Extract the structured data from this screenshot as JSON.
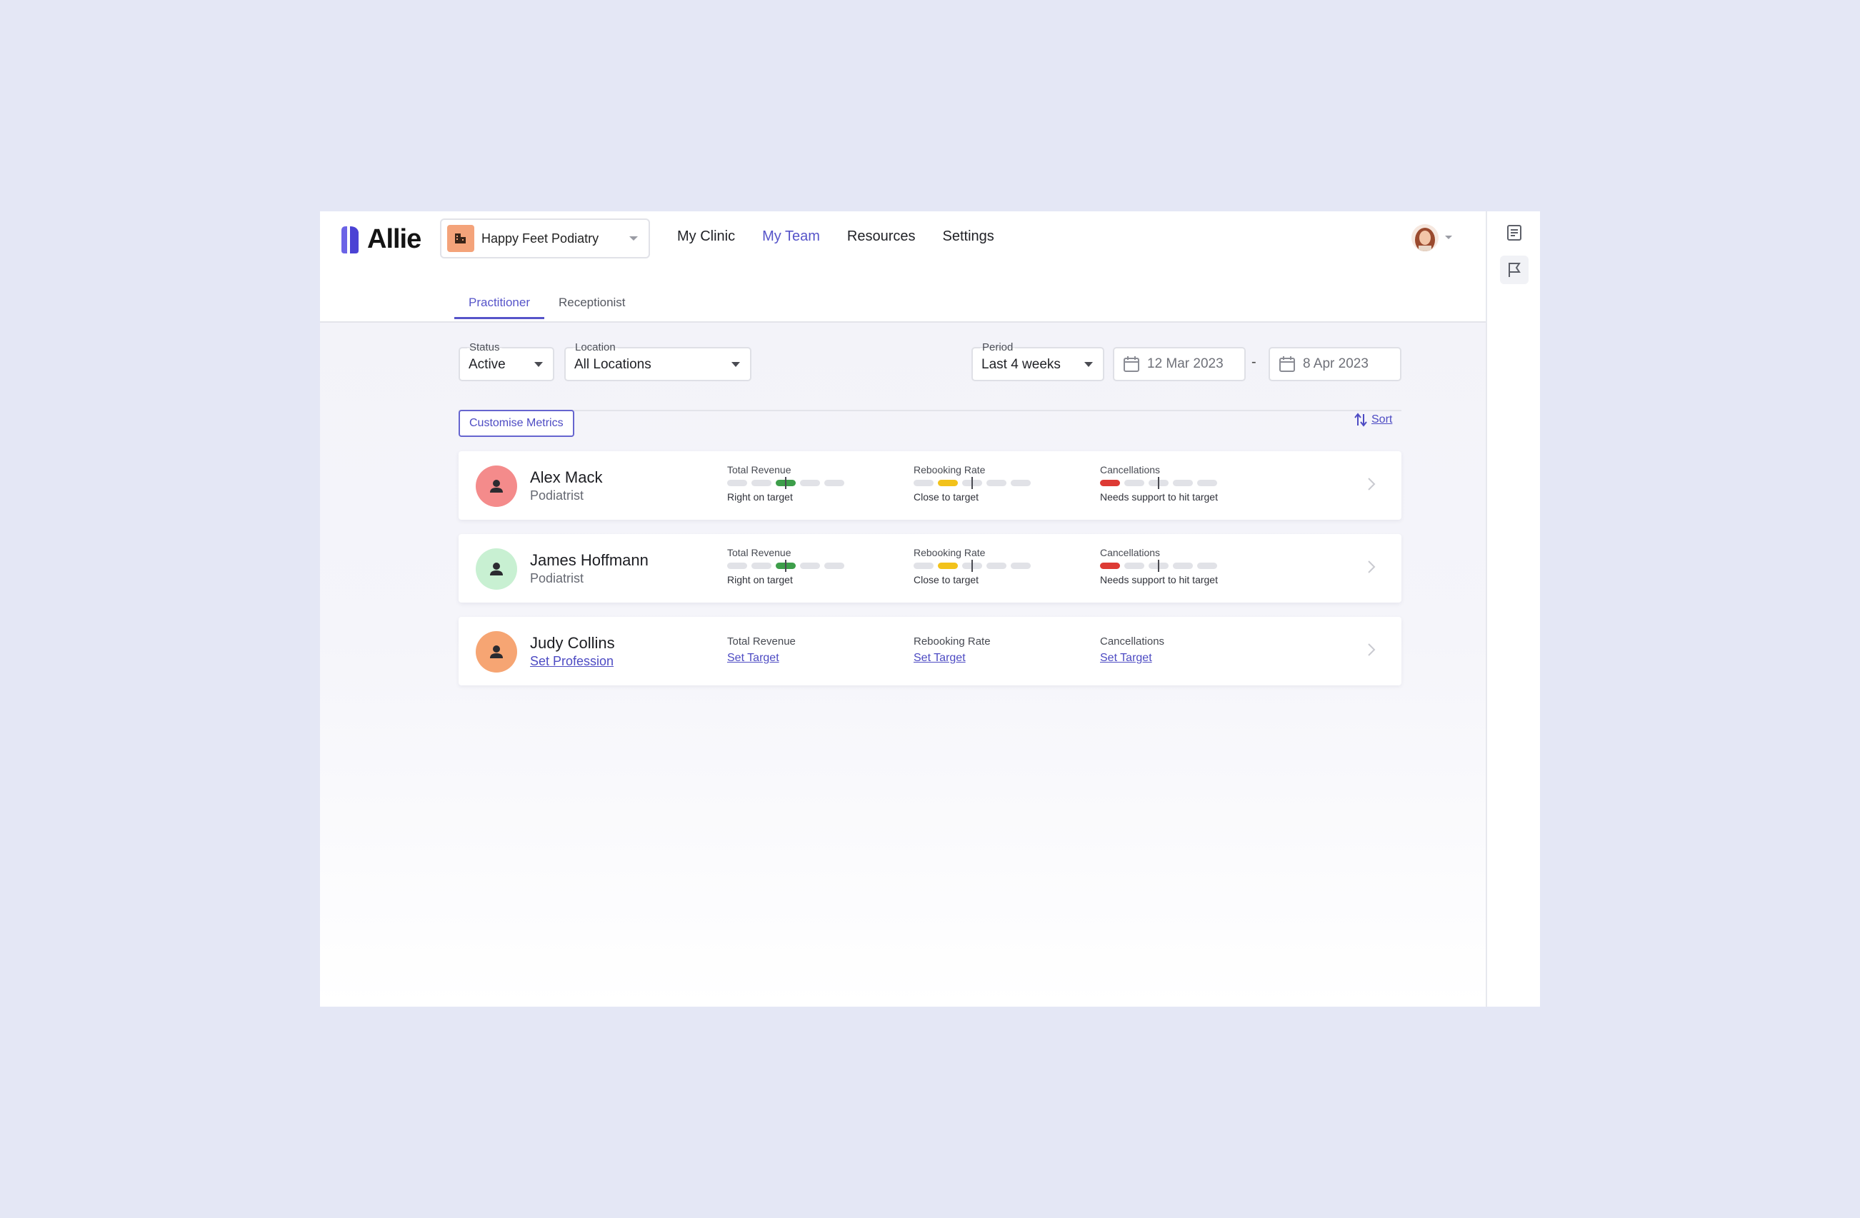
{
  "app": {
    "logo_text": "Allie",
    "clinic": "Happy Feet Podiatry",
    "nav": [
      "My Clinic",
      "My Team",
      "Resources",
      "Settings"
    ],
    "active_nav": "My Team",
    "accent_color": "#5654c9"
  },
  "tabs": [
    "Practitioner",
    "Receptionist"
  ],
  "filters": {
    "status_label": "Status",
    "status_value": "Active",
    "location_label": "Location",
    "location_value": "All Locations",
    "period_label": "Period",
    "period_value": "Last 4 weeks",
    "start_date": "12 Mar 2023",
    "date_separator": "-",
    "end_date": "8 Apr 2023"
  },
  "toolbar": {
    "customise_label": "Customise Metrics",
    "sort_label": "Sort"
  },
  "team": [
    {
      "name": "Alex Mack",
      "role": "Podiatrist",
      "avatar_color": "#f48b8b",
      "metrics": [
        {
          "label": "Total Revenue",
          "status": "Right on target"
        },
        {
          "label": "Rebooking Rate",
          "status": "Close to target"
        },
        {
          "label": "Cancellations",
          "status": "Needs support to hit target"
        }
      ]
    },
    {
      "name": "James Hoffmann",
      "role": "Podiatrist",
      "avatar_color": "#c8f0d2",
      "metrics": [
        {
          "label": "Total Revenue",
          "status": "Right on target"
        },
        {
          "label": "Rebooking Rate",
          "status": "Close to target"
        },
        {
          "label": "Cancellations",
          "status": "Needs support to hit target"
        }
      ]
    },
    {
      "name": "Judy Collins",
      "role": "Set Profession",
      "avatar_color": "#f6a573",
      "metrics": [
        {
          "label": "Total Revenue",
          "action": "Set Target"
        },
        {
          "label": "Rebooking Rate",
          "action": "Set Target"
        },
        {
          "label": "Cancellations",
          "action": "Set Target"
        }
      ]
    }
  ],
  "icons": {
    "rail": [
      "document-icon",
      "flag-icon"
    ],
    "clinic": "building-icon",
    "date": "calendar-icon",
    "sort": "sort-arrows-icon",
    "card": "chevron-right-icon",
    "avatar": "person-icon"
  }
}
